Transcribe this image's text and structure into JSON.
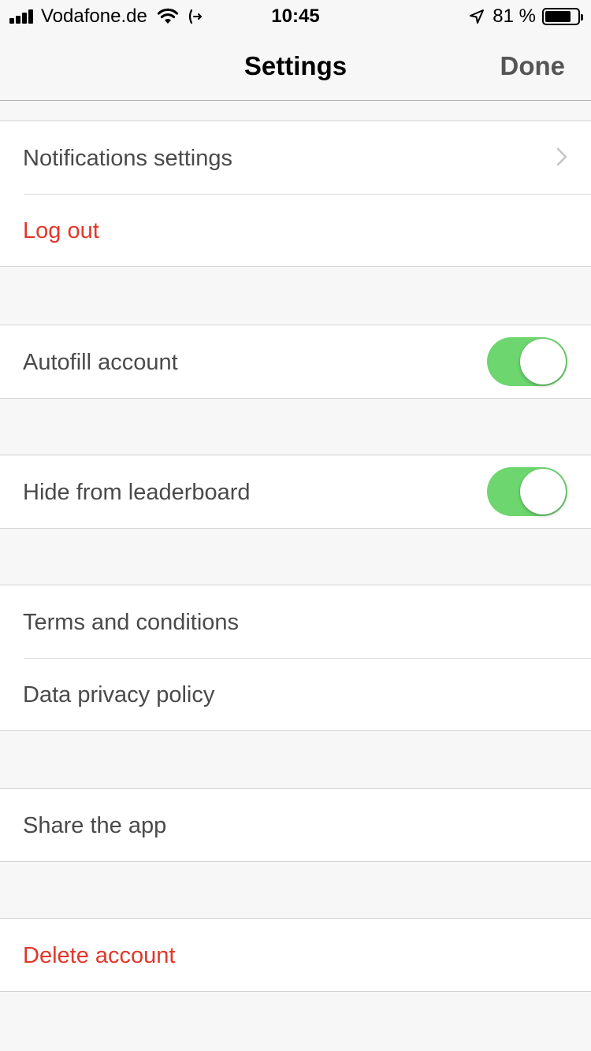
{
  "status_bar": {
    "carrier": "Vodafone.de",
    "time": "10:45",
    "battery_percent": "81 %",
    "battery_level": 0.81,
    "icons": [
      "signal-icon",
      "wifi-icon",
      "call-forwarding-icon",
      "location-arrow-icon",
      "battery-icon"
    ]
  },
  "nav": {
    "title": "Settings",
    "done_label": "Done"
  },
  "groups": [
    {
      "items": [
        {
          "label": "Notifications settings",
          "accessory": "chevron"
        },
        {
          "label": "Log out",
          "style": "destructive"
        }
      ]
    },
    {
      "items": [
        {
          "label": "Autofill account",
          "accessory": "switch",
          "on": true
        }
      ]
    },
    {
      "items": [
        {
          "label": "Hide from leaderboard",
          "accessory": "switch",
          "on": true
        }
      ]
    },
    {
      "items": [
        {
          "label": "Terms and conditions"
        },
        {
          "label": "Data privacy policy"
        }
      ]
    },
    {
      "items": [
        {
          "label": "Share the app"
        }
      ]
    },
    {
      "items": [
        {
          "label": "Delete account",
          "style": "destructive"
        }
      ]
    }
  ],
  "colors": {
    "switch_on": "#6dd66f",
    "destructive": "#e0382b",
    "label": "#4a4a4a",
    "background": "#f7f7f7"
  }
}
